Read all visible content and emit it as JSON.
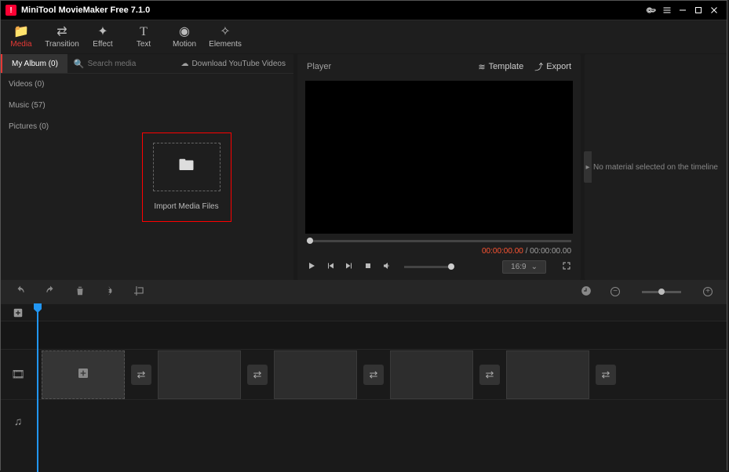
{
  "titlebar": {
    "app_title": "MiniTool MovieMaker Free 7.1.0"
  },
  "tabs": {
    "media": "Media",
    "transition": "Transition",
    "effect": "Effect",
    "text": "Text",
    "motion": "Motion",
    "elements": "Elements"
  },
  "media": {
    "album_tab": "My Album (0)",
    "search_placeholder": "Search media",
    "yt_download": "Download YouTube Videos",
    "cats": {
      "videos": "Videos (0)",
      "music": "Music (57)",
      "pictures": "Pictures (0)"
    },
    "import_label": "Import Media Files"
  },
  "player": {
    "title": "Player",
    "template": "Template",
    "export": "Export",
    "current_time": "00:00:00.00",
    "total_time": "00:00:00.00",
    "aspect": "16:9"
  },
  "side": {
    "empty_msg": "No material selected on the timeline"
  }
}
